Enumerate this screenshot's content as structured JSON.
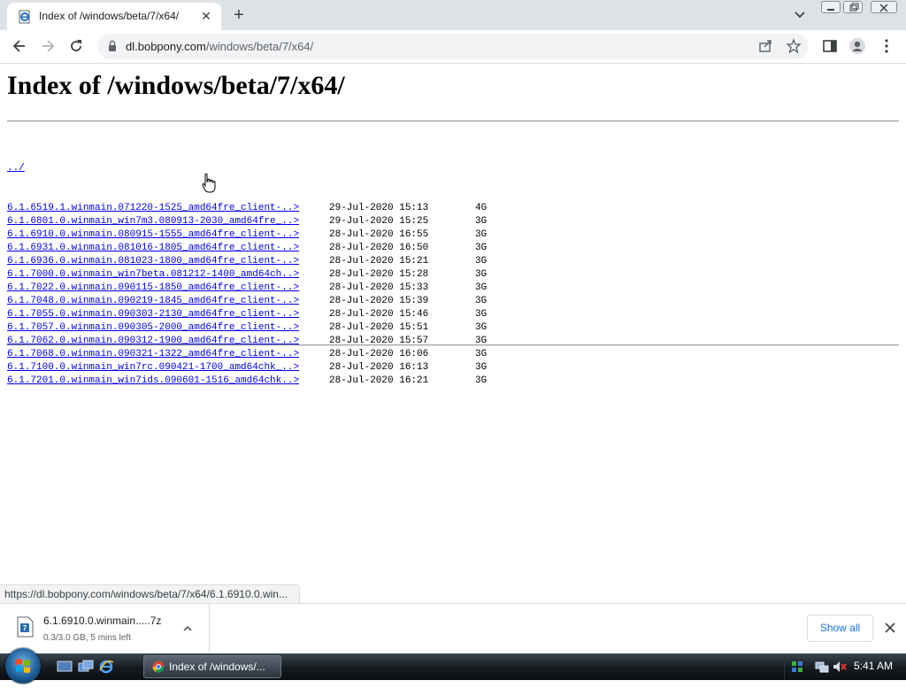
{
  "browser": {
    "tab_title": "Index of /windows/beta/7/x64/",
    "url_host": "dl.bobpony.com",
    "url_path": "/windows/beta/7/x64/"
  },
  "page": {
    "title": "Index of /windows/beta/7/x64/",
    "parent_link": "../",
    "rows": [
      {
        "name": "6.1.6519.1.winmain.071220-1525_amd64fre_client-..>",
        "date": "29-Jul-2020 15:13",
        "size": "4G"
      },
      {
        "name": "6.1.6801.0.winmain_win7m3.080913-2030_amd64fre_..>",
        "date": "29-Jul-2020 15:25",
        "size": "3G"
      },
      {
        "name": "6.1.6910.0.winmain.080915-1555_amd64fre_client-..>",
        "date": "28-Jul-2020 16:55",
        "size": "3G"
      },
      {
        "name": "6.1.6931.0.winmain.081016-1805_amd64fre_client-..>",
        "date": "28-Jul-2020 16:50",
        "size": "3G"
      },
      {
        "name": "6.1.6936.0.winmain.081023-1800_amd64fre_client-..>",
        "date": "28-Jul-2020 15:21",
        "size": "3G"
      },
      {
        "name": "6.1.7000.0.winmain_win7beta.081212-1400_amd64ch..>",
        "date": "28-Jul-2020 15:28",
        "size": "3G"
      },
      {
        "name": "6.1.7022.0.winmain.090115-1850_amd64fre_client-..>",
        "date": "28-Jul-2020 15:33",
        "size": "3G"
      },
      {
        "name": "6.1.7048.0.winmain.090219-1845_amd64fre_client-..>",
        "date": "28-Jul-2020 15:39",
        "size": "3G"
      },
      {
        "name": "6.1.7055.0.winmain.090303-2130_amd64fre_client-..>",
        "date": "28-Jul-2020 15:46",
        "size": "3G"
      },
      {
        "name": "6.1.7057.0.winmain.090305-2000_amd64fre_client-..>",
        "date": "28-Jul-2020 15:51",
        "size": "3G"
      },
      {
        "name": "6.1.7062.0.winmain.090312-1900_amd64fre_client-..>",
        "date": "28-Jul-2020 15:57",
        "size": "3G"
      },
      {
        "name": "6.1.7068.0.winmain.090321-1322_amd64fre_client-..>",
        "date": "28-Jul-2020 16:06",
        "size": "3G"
      },
      {
        "name": "6.1.7100.0.winmain_win7rc.090421-1700_amd64chk_..>",
        "date": "28-Jul-2020 16:13",
        "size": "3G"
      },
      {
        "name": "6.1.7201.0.winmain_win7ids.090601-1516_amd64chk..>",
        "date": "28-Jul-2020 16:21",
        "size": "3G"
      }
    ]
  },
  "status_url": "https://dl.bobpony.com/windows/beta/7/x64/6.1.6910.0.win...",
  "download": {
    "name": "6.1.6910.0.winmain.....7z",
    "status": "0.3/3.0 GB, 5 mins left",
    "show_all": "Show all"
  },
  "taskbar": {
    "task_label": "Index of /windows/...",
    "clock": "5:41 AM"
  },
  "icons": {
    "tab_favicon": "ie-page-icon",
    "back": "arrow-left-icon",
    "forward": "arrow-right-icon",
    "reload": "reload-icon",
    "share": "share-icon",
    "bookmark": "star-icon",
    "side_panel": "side-panel-icon",
    "profile": "profile-icon",
    "menu": "kebab-menu-icon"
  },
  "colors": {
    "link": "#0000ee",
    "accent": "#1a73e8",
    "tabstrip": "#dee1e6"
  }
}
